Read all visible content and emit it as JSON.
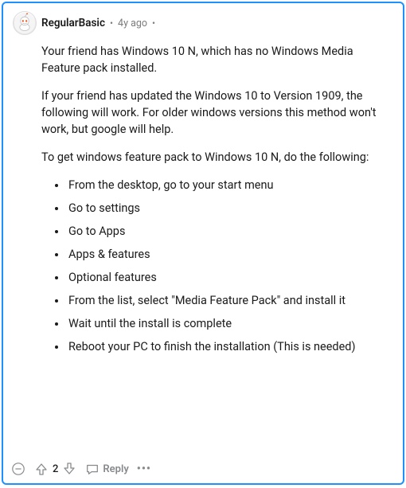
{
  "comment": {
    "username": "RegularBasic",
    "timestamp": "4y ago",
    "paragraphs": [
      "Your friend has Windows 10 N, which has no Windows Media Feature pack installed.",
      "If your friend has updated the Windows 10 to Version 1909, the following will work. For older windows versions this method won't work, but google will help.",
      "To get windows feature pack to Windows 10 N, do the following:"
    ],
    "list": [
      "From the desktop, go to your start menu",
      "Go to settings",
      "Go to Apps",
      "Apps & features",
      "Optional features",
      "From the list, select \"Media Feature Pack\" and install it",
      "Wait until the install is complete",
      "Reboot your PC to finish the installation (This is needed)"
    ]
  },
  "footer": {
    "score": "2",
    "reply_label": "Reply"
  }
}
